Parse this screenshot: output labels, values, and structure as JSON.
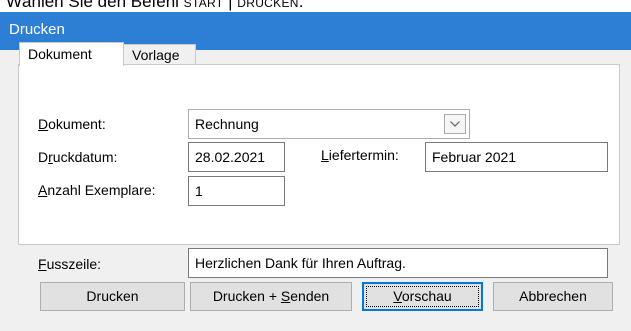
{
  "instruction": {
    "prefix": "Wählen Sie den Befehl ",
    "cmd_start": "START",
    "separator": " | ",
    "cmd_action": "DRUCKEN",
    "suffix": "."
  },
  "window": {
    "title": "Drucken"
  },
  "tabs": [
    {
      "label": "Dokument",
      "active": true
    },
    {
      "label": "Vorlage",
      "active": false
    }
  ],
  "form": {
    "dokument": {
      "label_ul": "D",
      "label_rest": "okument:",
      "value": "Rechnung"
    },
    "druckdatum": {
      "label_pre": "D",
      "label_ul": "r",
      "label_rest": "uckdatum:",
      "value": "28.02.2021"
    },
    "liefertermin": {
      "label_ul": "L",
      "label_rest": "iefertermin:",
      "value": "Februar 2021"
    },
    "anzahl": {
      "label_ul": "A",
      "label_rest": "nzahl Exemplare:",
      "value": "1"
    },
    "fusszeile": {
      "label_ul": "F",
      "label_rest": "usszeile:",
      "value": "Herzlichen Dank für Ihren Auftrag."
    }
  },
  "buttons": {
    "drucken": "Drucken",
    "drucken_senden_pre": "Drucken + ",
    "drucken_senden_ul": "S",
    "drucken_senden_rest": "enden",
    "vorschau_ul": "V",
    "vorschau_rest": "orschau",
    "abbrechen": "Abbrechen"
  },
  "icons": {
    "dropdown": "chevron-down-icon"
  },
  "colors": {
    "titlebar": "#2d7fd6",
    "default_button_border": "#0078d7"
  }
}
